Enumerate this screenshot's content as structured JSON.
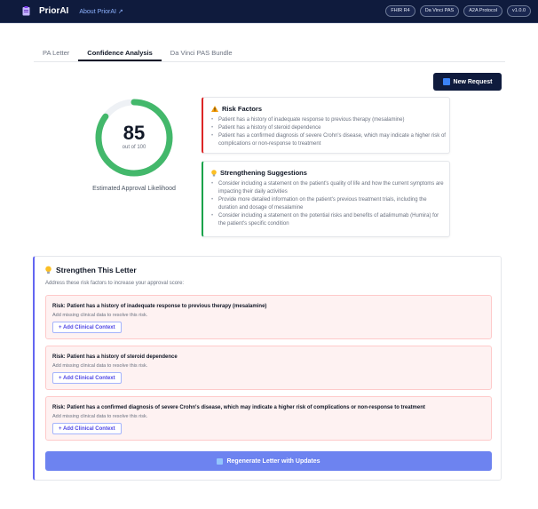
{
  "header": {
    "brand": "PriorAI",
    "about_link": "About PriorAI ↗",
    "badges": [
      "FHIR R4",
      "Da Vinci PAS",
      "A2A Protocol",
      "v1.0.0"
    ]
  },
  "tabs": [
    {
      "label": "PA Letter",
      "active": false
    },
    {
      "label": "Confidence Analysis",
      "active": true
    },
    {
      "label": "Da Vinci PAS Bundle",
      "active": false
    }
  ],
  "new_request_label": "New Request",
  "gauge": {
    "score": "85",
    "out_of": "out of 100",
    "value": 85,
    "max": 100,
    "caption": "Estimated Approval Likelihood",
    "color": "#43b86b",
    "track_color": "#eef1f5"
  },
  "risk_factors": {
    "title": "Risk Factors",
    "items": [
      "Patient has a history of inadequate response to previous therapy (mesalamine)",
      "Patient has a history of steroid dependence",
      "Patient has a confirmed diagnosis of severe Crohn's disease, which may indicate a higher risk of complications or non-response to treatment"
    ]
  },
  "strengthening": {
    "title": "Strengthening Suggestions",
    "items": [
      "Consider including a statement on the patient's quality of life and how the current symptoms are impacting their daily activities",
      "Provide more detailed information on the patient's previous treatment trials, including the duration and dosage of mesalamine",
      "Consider including a statement on the potential risks and benefits of adalimumab (Humira) for the patient's specific condition"
    ]
  },
  "strengthen_letter": {
    "title": "Strengthen This Letter",
    "subtitle": "Address these risk factors to increase your approval score:",
    "items": [
      {
        "title": "Risk: Patient has a history of inadequate response to previous therapy (mesalamine)",
        "note": "Add missing clinical data to resolve this risk.",
        "button": "+ Add Clinical Context"
      },
      {
        "title": "Risk: Patient has a history of steroid dependence",
        "note": "Add missing clinical data to resolve this risk.",
        "button": "+ Add Clinical Context"
      },
      {
        "title": "Risk: Patient has a confirmed diagnosis of severe Crohn's disease, which may indicate a higher risk of complications or non-response to treatment",
        "note": "Add missing clinical data to resolve this risk.",
        "button": "+ Add Clinical Context"
      }
    ],
    "regenerate_label": "Regenerate Letter with Updates"
  }
}
